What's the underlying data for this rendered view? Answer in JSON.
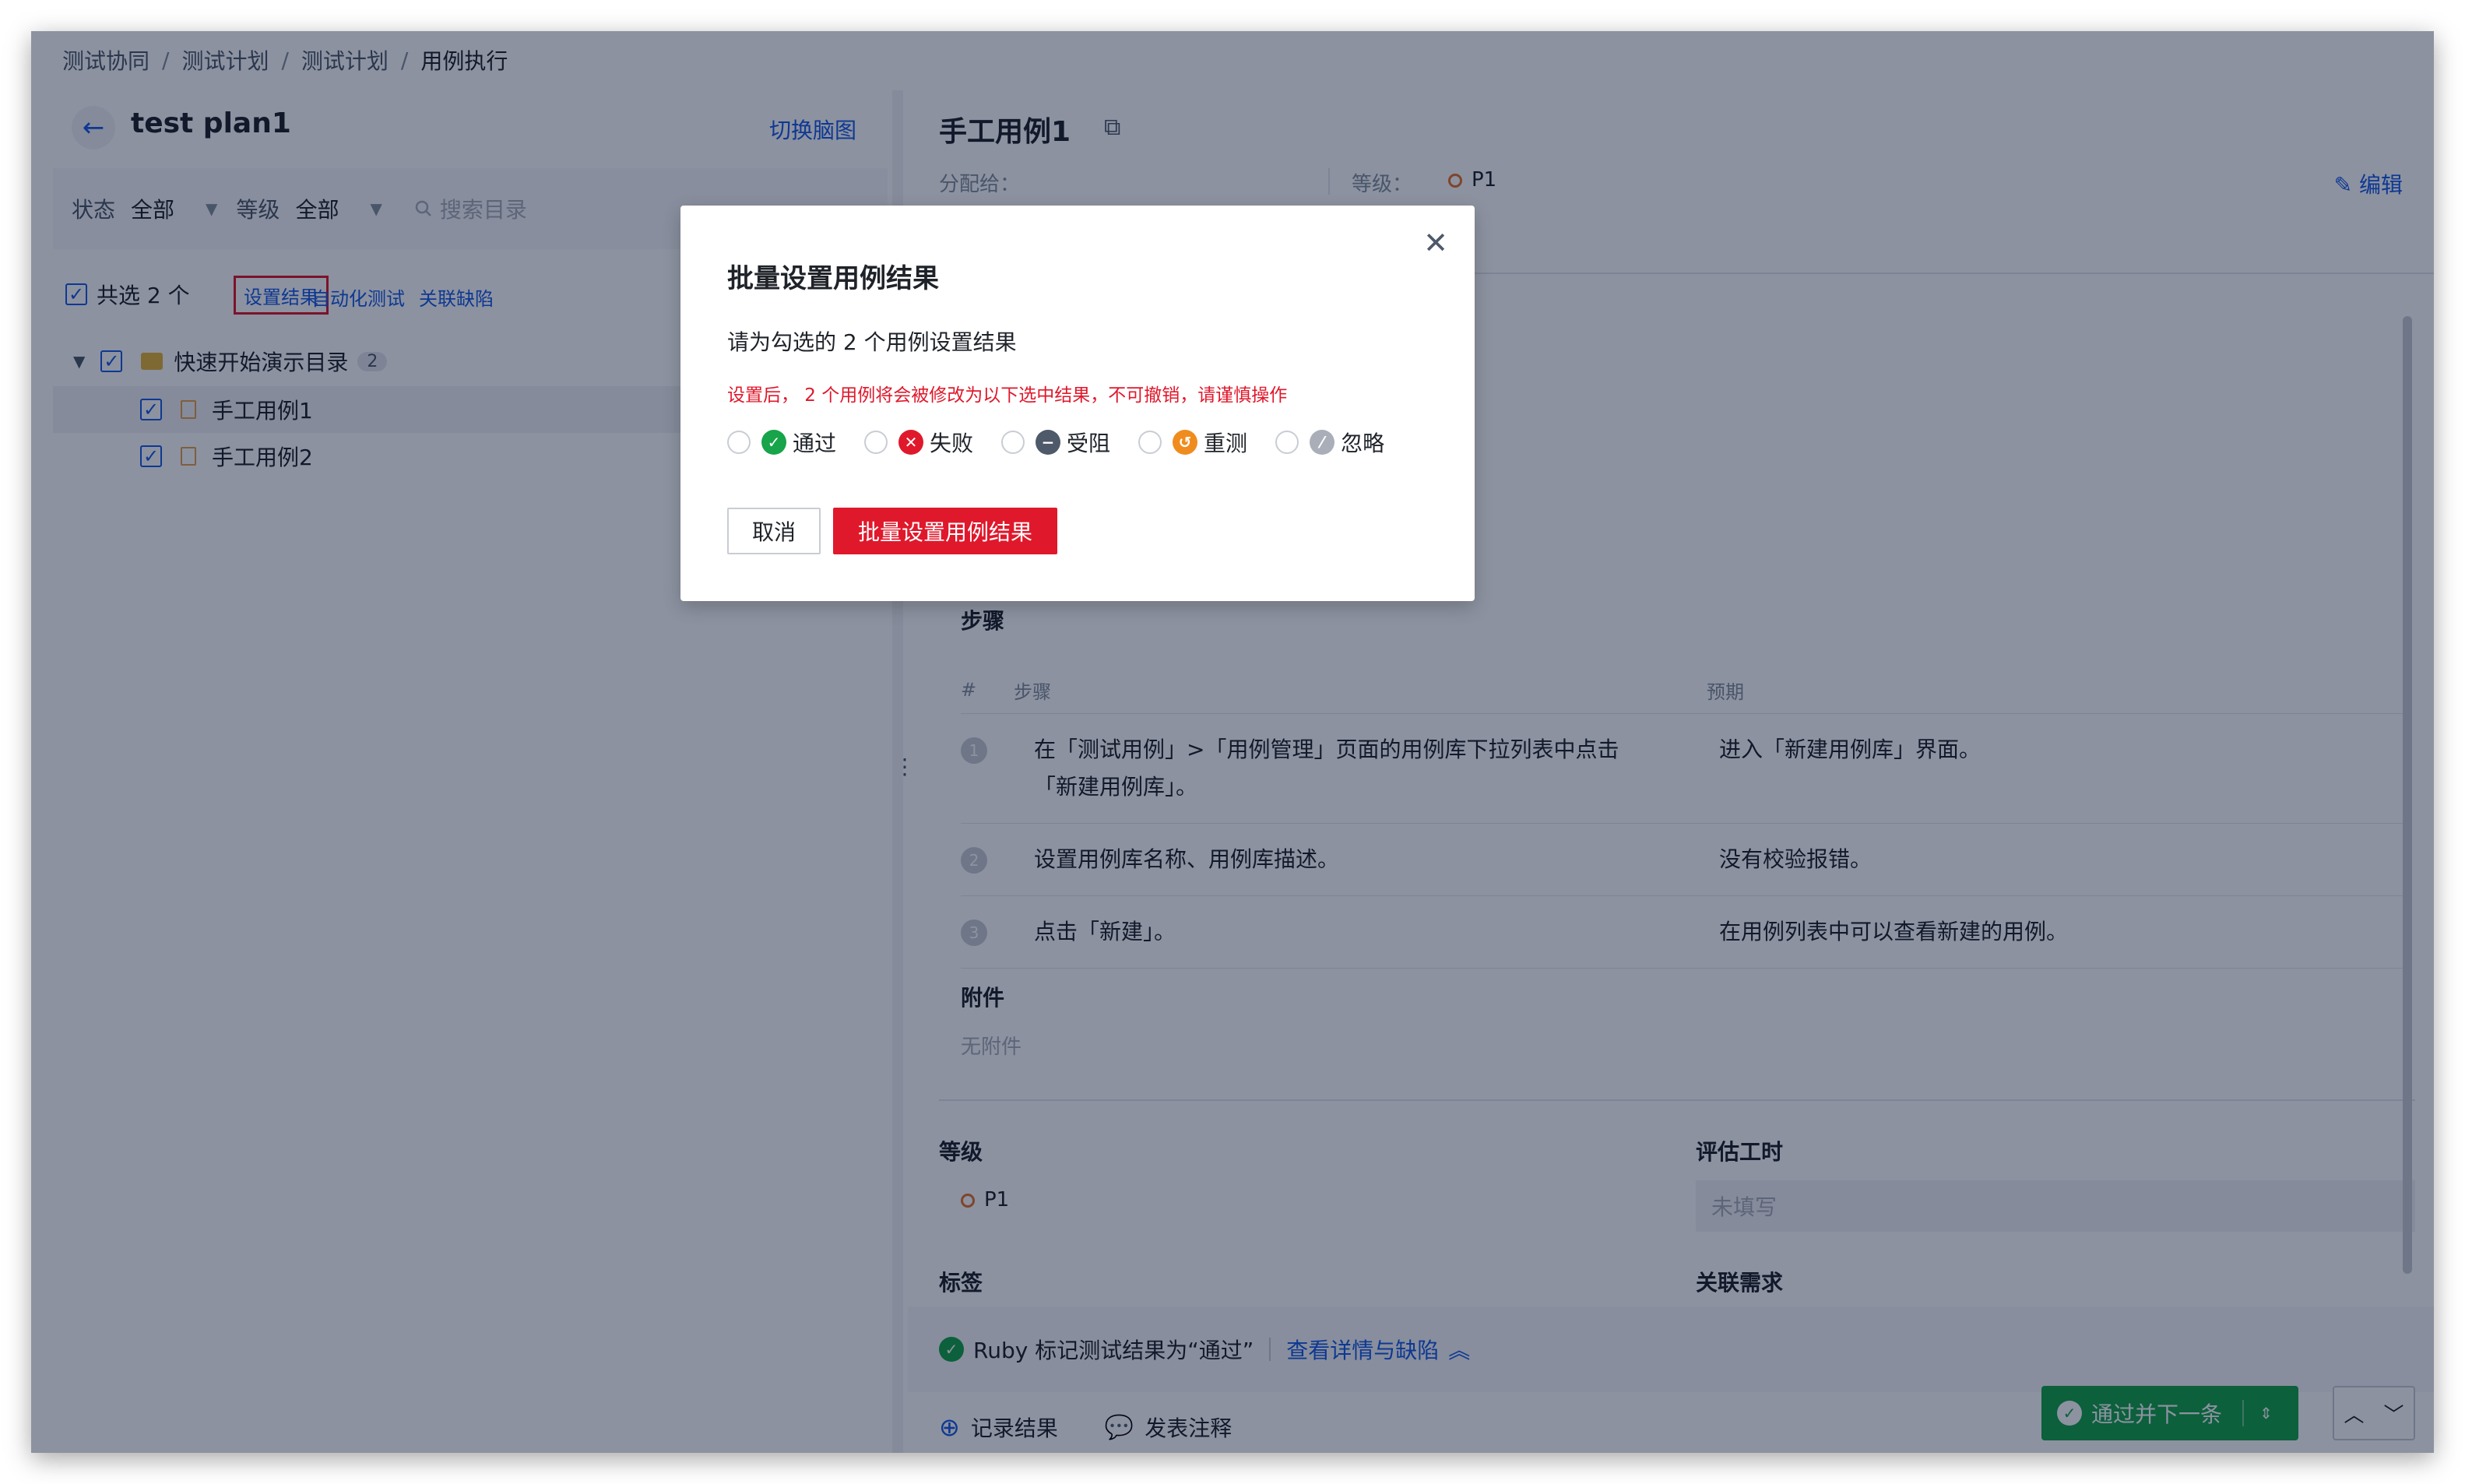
{
  "breadcrumb": [
    "测试协同",
    "测试计划",
    "测试计划",
    "用例执行"
  ],
  "left": {
    "plan_title": "test plan1",
    "switch_view": "切换脑图",
    "filter": {
      "status_label": "状态",
      "status_value": "全部",
      "level_label": "等级",
      "level_value": "全部",
      "search_placeholder": "搜索目录"
    },
    "selection": {
      "count_text": "共选 2 个",
      "set_result": "设置结果",
      "automation": "自动化测试",
      "link_defect": "关联缺陷"
    },
    "tree": {
      "folder_name": "快速开始演示目录",
      "folder_count": "2",
      "cases": [
        "手工用例1",
        "手工用例2"
      ]
    }
  },
  "right": {
    "case_title": "手工用例1",
    "assignee_label": "分配给：",
    "level_label": "等级：",
    "level_value": "P1",
    "edit": "编辑",
    "steps_title": "步骤",
    "steps_header": {
      "num": "#",
      "step": "步骤",
      "expect": "预期"
    },
    "steps": [
      {
        "num": "1",
        "step": "在「测试用例」>「用例管理」页面的用例库下拉列表中点击「新建用例库」。",
        "expect": "进入「新建用例库」界面。"
      },
      {
        "num": "2",
        "step": "设置用例库名称、用例库描述。",
        "expect": "没有校验报错。"
      },
      {
        "num": "3",
        "step": "点击「新建」。",
        "expect": "在用例列表中可以查看新建的用例。"
      }
    ],
    "attachments_title": "附件",
    "attachments_empty": "无附件",
    "grade_title": "等级",
    "grade_value": "P1",
    "estimate_title": "评估工时",
    "estimate_placeholder": "未填写",
    "tags_title": "标签",
    "related_title": "关联需求",
    "status_text": "Ruby 标记测试结果为“通过”",
    "view_details": "查看详情与缺陷",
    "record_result": "记录结果",
    "post_comment": "发表注释",
    "pass_next": "通过并下一条"
  },
  "modal": {
    "title": "批量设置用例结果",
    "desc": "请为勾选的 2 个用例设置结果",
    "warning": "设置后， 2 个用例将会被修改为以下选中结果，不可撤销，请谨慎操作",
    "options": [
      {
        "label": "通过",
        "color": "#17a44a",
        "icon": "check-icon"
      },
      {
        "label": "失败",
        "color": "#e0182b",
        "icon": "cross-icon"
      },
      {
        "label": "受阻",
        "color": "#4e5969",
        "icon": "minus-icon"
      },
      {
        "label": "重测",
        "color": "#f08c1e",
        "icon": "retry-icon"
      },
      {
        "label": "忽略",
        "color": "#a9aeb8",
        "icon": "slash-icon"
      }
    ],
    "cancel": "取消",
    "confirm": "批量设置用例结果"
  }
}
